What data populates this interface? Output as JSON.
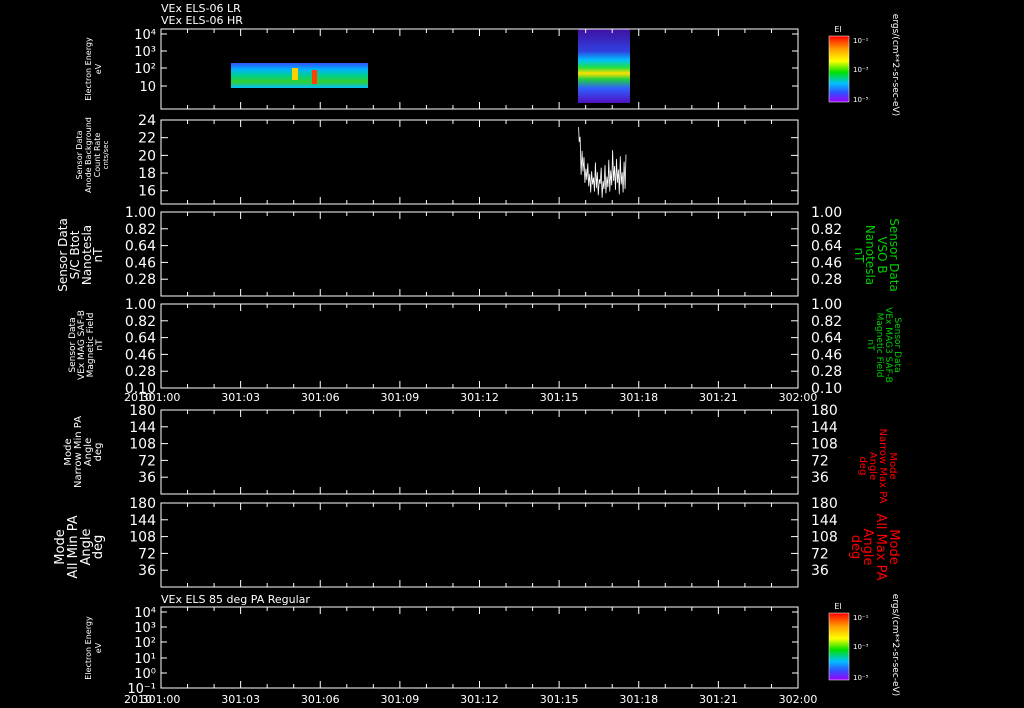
{
  "header": {
    "lines": [
      "VEx ELS-06 LR",
      "VEx ELS-06 HR"
    ]
  },
  "time_axis": {
    "year": "2010",
    "ticks": [
      "301:00",
      "301:03",
      "301:06",
      "301:09",
      "301:12",
      "301:15",
      "301:18",
      "301:21",
      "302:00"
    ]
  },
  "colors": {
    "white": "#ffffff",
    "green": "#00d000",
    "red": "#ff0000",
    "background": "#000000"
  },
  "colorbar": {
    "title": "El",
    "labels": [
      "10⁻¹",
      "10⁻³",
      "10⁻⁵"
    ]
  },
  "units_label": "ergs/(cm**2-sr-sec-eV)",
  "chart_data": [
    {
      "type": "heatmap",
      "title": "",
      "ylabel": [
        "Electron Energy",
        "eV"
      ],
      "y_scale": "log",
      "y_ticks": [
        "10⁴",
        "10³",
        "10²",
        "10"
      ],
      "ylim": [
        1,
        10000
      ],
      "x_ticks": [
        "301:00",
        "301:03",
        "301:06",
        "301:09",
        "301:12",
        "301:15",
        "301:18",
        "301:21",
        "302:00"
      ],
      "data_intervals": [
        {
          "start_day": 301.04,
          "end_day": 301.2,
          "energy_range_eV": [
            7,
            200
          ]
        },
        {
          "start_day": 301.66,
          "end_day": 301.73,
          "energy_range_eV": [
            1,
            10000
          ]
        }
      ]
    },
    {
      "type": "line",
      "ylabel": [
        "Sensor Data",
        "Anode Background",
        "Count Rate",
        "cnts/sec"
      ],
      "y_ticks": [
        24,
        22,
        20,
        18,
        16
      ],
      "ylim": [
        14.5,
        24
      ],
      "series": [
        {
          "x": [
            301.6555,
            301.6565,
            301.658,
            301.6595,
            301.661,
            301.6625,
            301.664,
            301.6655,
            301.667,
            301.6685,
            301.67,
            301.6715,
            301.673,
            301.6745,
            301.676,
            301.6775,
            301.679,
            301.6805,
            301.682,
            301.6835,
            301.685,
            301.6865,
            301.688,
            301.6895,
            301.691,
            301.6925,
            301.694,
            301.6955,
            301.697,
            301.6985,
            301.7,
            301.7015,
            301.703,
            301.7045,
            301.706,
            301.7075,
            301.709,
            301.7105,
            301.712,
            301.7135,
            301.715,
            301.7165,
            301.718,
            301.7195,
            301.721,
            301.7225,
            301.724,
            301.7255,
            301.727,
            301.7285,
            301.73
          ],
          "y": [
            23.2,
            21.5,
            22.1,
            17.8,
            20.5,
            18.2,
            19.8,
            16.9,
            18.5,
            17.2,
            19.1,
            16.5,
            17.9,
            15.8,
            18.2,
            16.7,
            17.5,
            15.9,
            19.2,
            16.3,
            18.1,
            15.5,
            17.3,
            16.8,
            18.6,
            15.2,
            17.1,
            16.2,
            18.9,
            15.7,
            17.6,
            16.4,
            19.5,
            15.9,
            18.3,
            16.6,
            20.6,
            17.1,
            18.8,
            16.1,
            19.6,
            16.9,
            18.4,
            15.6,
            19.9,
            16.7,
            18.1,
            15.8,
            19.3,
            16.2,
            20.1
          ]
        }
      ]
    },
    {
      "type": "line",
      "ylabel": [
        "Sensor Data",
        "S/C Btot",
        "Nanotesla",
        "nT"
      ],
      "y2label": [
        "Sensor Data",
        "VSO B",
        "Nanotesla",
        "nT"
      ],
      "y_ticks": [
        "1.00",
        "0.82",
        "0.64",
        "0.46",
        "0.28"
      ],
      "ylim": [
        0.1,
        1.0
      ],
      "series": []
    },
    {
      "type": "line",
      "ylabel": [
        "Sensor Data",
        "VEx MAG SAF-B",
        "Magnetic Field",
        "nT"
      ],
      "y2label": [
        "Sensor Data",
        "VEx MAG3 SAF-B",
        "Magnetic Field",
        "nT"
      ],
      "y_ticks": [
        "1.00",
        "0.82",
        "0.64",
        "0.46",
        "0.28",
        "0.10"
      ],
      "ylim": [
        0.1,
        1.0
      ],
      "series": []
    },
    {
      "type": "line",
      "ylabel": [
        "Mode",
        "Narrow Min PA",
        "Angle",
        "deg"
      ],
      "y2label": [
        "Mode",
        "Narrow Max PA",
        "Angle",
        "deg"
      ],
      "y_ticks": [
        "180",
        "144",
        "108",
        "72",
        "36"
      ],
      "ylim": [
        0,
        180
      ],
      "series": []
    },
    {
      "type": "line",
      "ylabel": [
        "Mode",
        "All Min PA",
        "Angle",
        "deg"
      ],
      "y2label": [
        "Mode",
        "All Max PA",
        "Angle",
        "deg"
      ],
      "y_ticks": [
        "180",
        "144",
        "108",
        "72",
        "36"
      ],
      "ylim": [
        0,
        180
      ],
      "series": []
    },
    {
      "type": "heatmap",
      "title": "VEx ELS 85 deg PA Regular",
      "ylabel": [
        "Electron Energy",
        "eV"
      ],
      "y_scale": "log",
      "y_ticks": [
        "10⁴",
        "10³",
        "10²",
        "10¹",
        "10⁰",
        "10⁻¹"
      ],
      "ylim": [
        0.1,
        10000
      ],
      "data_intervals": []
    }
  ]
}
